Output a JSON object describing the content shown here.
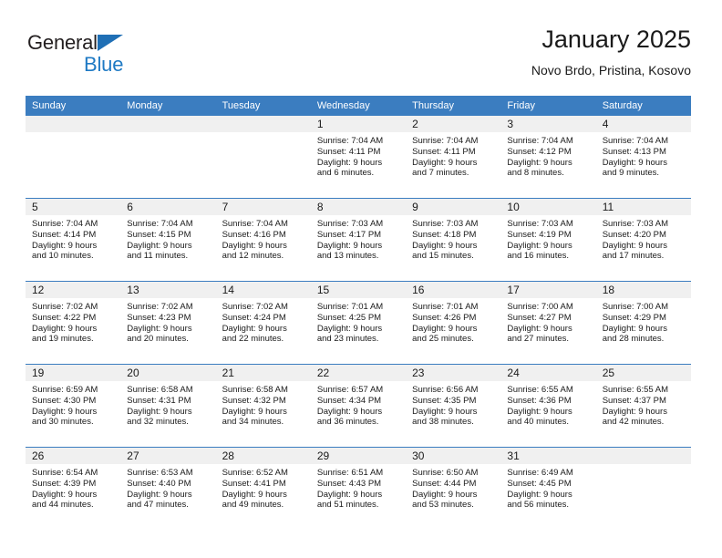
{
  "brand": {
    "name_part1": "General",
    "name_part2": "Blue",
    "flag_icon": "triangle-flag-icon",
    "colors": {
      "dark": "#231f20",
      "blue": "#1f7ac4"
    }
  },
  "header": {
    "title": "January 2025",
    "subtitle": "Novo Brdo, Pristina, Kosovo"
  },
  "colors": {
    "header_blue": "#3b7dc0",
    "daynum_band": "#f0f0f0",
    "text": "#1a1a1a"
  },
  "calendar": {
    "weekday_headers": [
      "Sunday",
      "Monday",
      "Tuesday",
      "Wednesday",
      "Thursday",
      "Friday",
      "Saturday"
    ],
    "weeks": [
      [
        {
          "day": "",
          "sunrise": "",
          "sunset": "",
          "daylight_line1": "",
          "daylight_line2": "",
          "empty": true
        },
        {
          "day": "",
          "sunrise": "",
          "sunset": "",
          "daylight_line1": "",
          "daylight_line2": "",
          "empty": true
        },
        {
          "day": "",
          "sunrise": "",
          "sunset": "",
          "daylight_line1": "",
          "daylight_line2": "",
          "empty": true
        },
        {
          "day": "1",
          "sunrise": "Sunrise: 7:04 AM",
          "sunset": "Sunset: 4:11 PM",
          "daylight_line1": "Daylight: 9 hours",
          "daylight_line2": "and 6 minutes."
        },
        {
          "day": "2",
          "sunrise": "Sunrise: 7:04 AM",
          "sunset": "Sunset: 4:11 PM",
          "daylight_line1": "Daylight: 9 hours",
          "daylight_line2": "and 7 minutes."
        },
        {
          "day": "3",
          "sunrise": "Sunrise: 7:04 AM",
          "sunset": "Sunset: 4:12 PM",
          "daylight_line1": "Daylight: 9 hours",
          "daylight_line2": "and 8 minutes."
        },
        {
          "day": "4",
          "sunrise": "Sunrise: 7:04 AM",
          "sunset": "Sunset: 4:13 PM",
          "daylight_line1": "Daylight: 9 hours",
          "daylight_line2": "and 9 minutes."
        }
      ],
      [
        {
          "day": "5",
          "sunrise": "Sunrise: 7:04 AM",
          "sunset": "Sunset: 4:14 PM",
          "daylight_line1": "Daylight: 9 hours",
          "daylight_line2": "and 10 minutes."
        },
        {
          "day": "6",
          "sunrise": "Sunrise: 7:04 AM",
          "sunset": "Sunset: 4:15 PM",
          "daylight_line1": "Daylight: 9 hours",
          "daylight_line2": "and 11 minutes."
        },
        {
          "day": "7",
          "sunrise": "Sunrise: 7:04 AM",
          "sunset": "Sunset: 4:16 PM",
          "daylight_line1": "Daylight: 9 hours",
          "daylight_line2": "and 12 minutes."
        },
        {
          "day": "8",
          "sunrise": "Sunrise: 7:03 AM",
          "sunset": "Sunset: 4:17 PM",
          "daylight_line1": "Daylight: 9 hours",
          "daylight_line2": "and 13 minutes."
        },
        {
          "day": "9",
          "sunrise": "Sunrise: 7:03 AM",
          "sunset": "Sunset: 4:18 PM",
          "daylight_line1": "Daylight: 9 hours",
          "daylight_line2": "and 15 minutes."
        },
        {
          "day": "10",
          "sunrise": "Sunrise: 7:03 AM",
          "sunset": "Sunset: 4:19 PM",
          "daylight_line1": "Daylight: 9 hours",
          "daylight_line2": "and 16 minutes."
        },
        {
          "day": "11",
          "sunrise": "Sunrise: 7:03 AM",
          "sunset": "Sunset: 4:20 PM",
          "daylight_line1": "Daylight: 9 hours",
          "daylight_line2": "and 17 minutes."
        }
      ],
      [
        {
          "day": "12",
          "sunrise": "Sunrise: 7:02 AM",
          "sunset": "Sunset: 4:22 PM",
          "daylight_line1": "Daylight: 9 hours",
          "daylight_line2": "and 19 minutes."
        },
        {
          "day": "13",
          "sunrise": "Sunrise: 7:02 AM",
          "sunset": "Sunset: 4:23 PM",
          "daylight_line1": "Daylight: 9 hours",
          "daylight_line2": "and 20 minutes."
        },
        {
          "day": "14",
          "sunrise": "Sunrise: 7:02 AM",
          "sunset": "Sunset: 4:24 PM",
          "daylight_line1": "Daylight: 9 hours",
          "daylight_line2": "and 22 minutes."
        },
        {
          "day": "15",
          "sunrise": "Sunrise: 7:01 AM",
          "sunset": "Sunset: 4:25 PM",
          "daylight_line1": "Daylight: 9 hours",
          "daylight_line2": "and 23 minutes."
        },
        {
          "day": "16",
          "sunrise": "Sunrise: 7:01 AM",
          "sunset": "Sunset: 4:26 PM",
          "daylight_line1": "Daylight: 9 hours",
          "daylight_line2": "and 25 minutes."
        },
        {
          "day": "17",
          "sunrise": "Sunrise: 7:00 AM",
          "sunset": "Sunset: 4:27 PM",
          "daylight_line1": "Daylight: 9 hours",
          "daylight_line2": "and 27 minutes."
        },
        {
          "day": "18",
          "sunrise": "Sunrise: 7:00 AM",
          "sunset": "Sunset: 4:29 PM",
          "daylight_line1": "Daylight: 9 hours",
          "daylight_line2": "and 28 minutes."
        }
      ],
      [
        {
          "day": "19",
          "sunrise": "Sunrise: 6:59 AM",
          "sunset": "Sunset: 4:30 PM",
          "daylight_line1": "Daylight: 9 hours",
          "daylight_line2": "and 30 minutes."
        },
        {
          "day": "20",
          "sunrise": "Sunrise: 6:58 AM",
          "sunset": "Sunset: 4:31 PM",
          "daylight_line1": "Daylight: 9 hours",
          "daylight_line2": "and 32 minutes."
        },
        {
          "day": "21",
          "sunrise": "Sunrise: 6:58 AM",
          "sunset": "Sunset: 4:32 PM",
          "daylight_line1": "Daylight: 9 hours",
          "daylight_line2": "and 34 minutes."
        },
        {
          "day": "22",
          "sunrise": "Sunrise: 6:57 AM",
          "sunset": "Sunset: 4:34 PM",
          "daylight_line1": "Daylight: 9 hours",
          "daylight_line2": "and 36 minutes."
        },
        {
          "day": "23",
          "sunrise": "Sunrise: 6:56 AM",
          "sunset": "Sunset: 4:35 PM",
          "daylight_line1": "Daylight: 9 hours",
          "daylight_line2": "and 38 minutes."
        },
        {
          "day": "24",
          "sunrise": "Sunrise: 6:55 AM",
          "sunset": "Sunset: 4:36 PM",
          "daylight_line1": "Daylight: 9 hours",
          "daylight_line2": "and 40 minutes."
        },
        {
          "day": "25",
          "sunrise": "Sunrise: 6:55 AM",
          "sunset": "Sunset: 4:37 PM",
          "daylight_line1": "Daylight: 9 hours",
          "daylight_line2": "and 42 minutes."
        }
      ],
      [
        {
          "day": "26",
          "sunrise": "Sunrise: 6:54 AM",
          "sunset": "Sunset: 4:39 PM",
          "daylight_line1": "Daylight: 9 hours",
          "daylight_line2": "and 44 minutes."
        },
        {
          "day": "27",
          "sunrise": "Sunrise: 6:53 AM",
          "sunset": "Sunset: 4:40 PM",
          "daylight_line1": "Daylight: 9 hours",
          "daylight_line2": "and 47 minutes."
        },
        {
          "day": "28",
          "sunrise": "Sunrise: 6:52 AM",
          "sunset": "Sunset: 4:41 PM",
          "daylight_line1": "Daylight: 9 hours",
          "daylight_line2": "and 49 minutes."
        },
        {
          "day": "29",
          "sunrise": "Sunrise: 6:51 AM",
          "sunset": "Sunset: 4:43 PM",
          "daylight_line1": "Daylight: 9 hours",
          "daylight_line2": "and 51 minutes."
        },
        {
          "day": "30",
          "sunrise": "Sunrise: 6:50 AM",
          "sunset": "Sunset: 4:44 PM",
          "daylight_line1": "Daylight: 9 hours",
          "daylight_line2": "and 53 minutes."
        },
        {
          "day": "31",
          "sunrise": "Sunrise: 6:49 AM",
          "sunset": "Sunset: 4:45 PM",
          "daylight_line1": "Daylight: 9 hours",
          "daylight_line2": "and 56 minutes."
        },
        {
          "day": "",
          "sunrise": "",
          "sunset": "",
          "daylight_line1": "",
          "daylight_line2": "",
          "empty": true
        }
      ]
    ]
  }
}
